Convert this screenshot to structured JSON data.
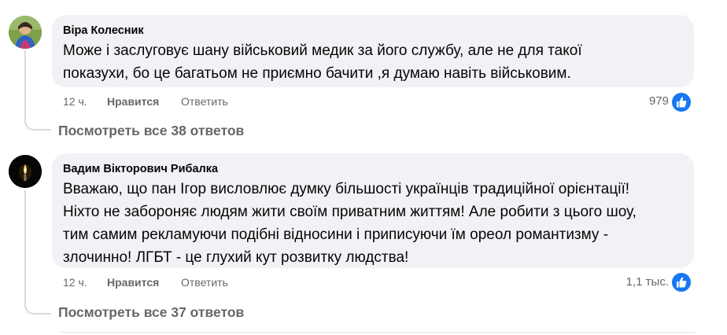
{
  "comments": [
    {
      "author": "Віра Колесник",
      "text_lines": [
        "Може і заслуговує шану військовий медик за його службу, але не для такої",
        "показухи, бо це багатьом не приємно бачити ,я думаю навіть військовим."
      ],
      "time": "12 ч.",
      "like_label": "Нравится",
      "reply_label": "Ответить",
      "reaction_count": "979",
      "view_replies": "Посмотреть все 38 ответов",
      "avatar_icon": "avatar-photo"
    },
    {
      "author": "Вадим Вікторович Рибалка",
      "text_lines": [
        "Вважаю, що пан Ігор висловлює думку більшості українців традиційної орієнтації!",
        "Ніхто не забороняє людям жити своїм приватним життям! Але робити з цього шоу,",
        "тим самим рекламуючи подібні відносини і приписуючи їм ореол романтизму -",
        "злочинно! ЛГБТ - це глухий кут розвитку людства!"
      ],
      "time": "12 ч.",
      "like_label": "Нравится",
      "reply_label": "Ответить",
      "reaction_count": "1,1 тыс.",
      "view_replies": "Посмотреть все 37 ответов",
      "avatar_icon": "candle-avatar"
    }
  ],
  "colors": {
    "bubble": "#f0f2f5",
    "meta_text": "#65676b",
    "like_blue": "#1877f2",
    "thread_line": "#d8dadf"
  },
  "icons": {
    "reaction": "like-thumb-icon"
  }
}
